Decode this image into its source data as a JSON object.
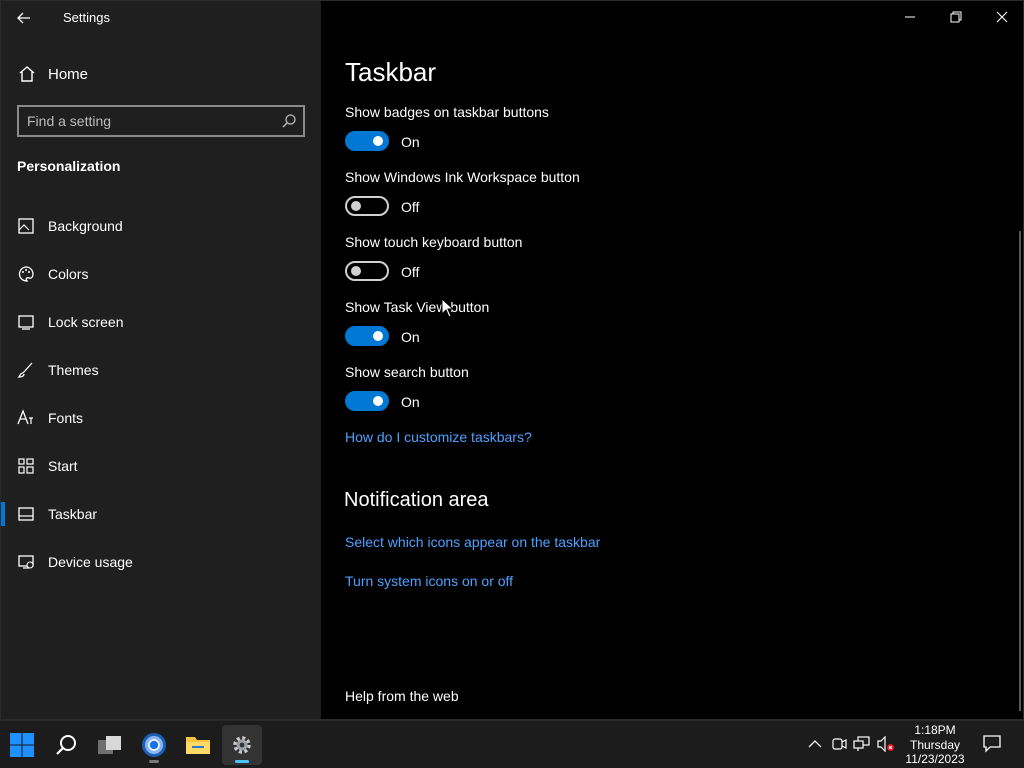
{
  "window": {
    "title": "Settings"
  },
  "sidebar": {
    "home_label": "Home",
    "search_placeholder": "Find a setting",
    "section_title": "Personalization",
    "items": [
      {
        "label": "Background",
        "icon": "image-icon"
      },
      {
        "label": "Colors",
        "icon": "palette-icon"
      },
      {
        "label": "Lock screen",
        "icon": "lock-screen-icon"
      },
      {
        "label": "Themes",
        "icon": "brush-icon"
      },
      {
        "label": "Fonts",
        "icon": "font-icon"
      },
      {
        "label": "Start",
        "icon": "start-tiles-icon"
      },
      {
        "label": "Taskbar",
        "icon": "taskbar-icon",
        "selected": true
      },
      {
        "label": "Device usage",
        "icon": "device-usage-icon"
      }
    ]
  },
  "main": {
    "title": "Taskbar",
    "settings": [
      {
        "label": "Show badges on taskbar buttons",
        "state": "On"
      },
      {
        "label": "Show Windows Ink Workspace button",
        "state": "Off"
      },
      {
        "label": "Show touch keyboard button",
        "state": "Off"
      },
      {
        "label": "Show Task View button",
        "state": "On"
      },
      {
        "label": "Show search button",
        "state": "On"
      }
    ],
    "customize_link": "How do I customize taskbars?",
    "notification_heading": "Notification area",
    "notification_links": [
      "Select which icons appear on the taskbar",
      "Turn system icons on or off"
    ],
    "help_heading": "Help from the web"
  },
  "taskbar": {
    "apps": [
      {
        "name": "start-button",
        "icon": "windows-logo-icon"
      },
      {
        "name": "search-button",
        "icon": "search-icon"
      },
      {
        "name": "task-view-button",
        "icon": "task-view-icon"
      },
      {
        "name": "chrome-button",
        "icon": "chrome-icon"
      },
      {
        "name": "file-explorer-button",
        "icon": "folder-icon"
      },
      {
        "name": "settings-app-button",
        "icon": "gear-icon",
        "active": true
      }
    ],
    "clock": {
      "time": "1:18PM",
      "day": "Thursday",
      "date": "11/23/2023"
    }
  },
  "colors": {
    "accent": "#0078d4",
    "link": "#4ea1ff",
    "sidebar_bg": "#1f1f1f",
    "content_bg": "#000000"
  }
}
